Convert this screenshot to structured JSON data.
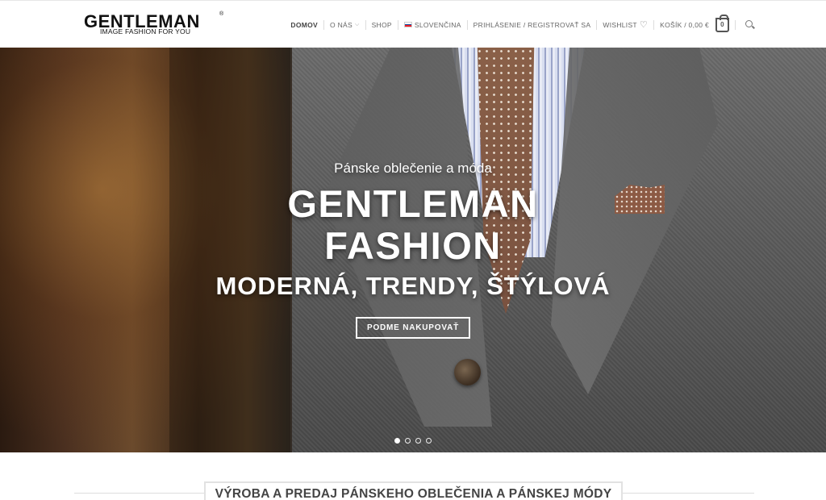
{
  "logo": {
    "brand": "GENTLEMAN",
    "registered": "®",
    "tagline": "IMAGE FASHION FOR YOU"
  },
  "nav": {
    "items": [
      {
        "label": "DOMOV",
        "active": true
      },
      {
        "label": "O NÁS",
        "has_dropdown": true
      },
      {
        "label": "SHOP"
      },
      {
        "label": "SLOVENČINA",
        "flag": "slovak-flag-icon"
      },
      {
        "label": "PRIHLÁSENIE / REGISTROVAŤ SA"
      },
      {
        "label": "WISHLIST",
        "icon": "heart-icon"
      },
      {
        "label": "KOŠÍK / 0,00 €",
        "icon": "cart-icon"
      }
    ],
    "cart_count": "0",
    "search_icon": "search-icon"
  },
  "hero": {
    "subtitle": "Pánske oblečenie a móda",
    "title_line1": "GENTLEMAN",
    "title_line2": "FASHION",
    "tagline": "MODERNÁ, TRENDY, ŠTÝLOVÁ",
    "cta_label": "PODME NAKUPOVAŤ",
    "slides_total": 4,
    "active_slide": 1
  },
  "section": {
    "title": "VÝROBA A PREDAJ PÁNSKEHO OBLEČENIA A PÁNSKEJ MÓDY"
  },
  "colors": {
    "accent": "#444444",
    "nav_text": "#666666",
    "flag_white": "#ffffff",
    "flag_blue": "#0b4ea2",
    "flag_red": "#ee1c25"
  }
}
